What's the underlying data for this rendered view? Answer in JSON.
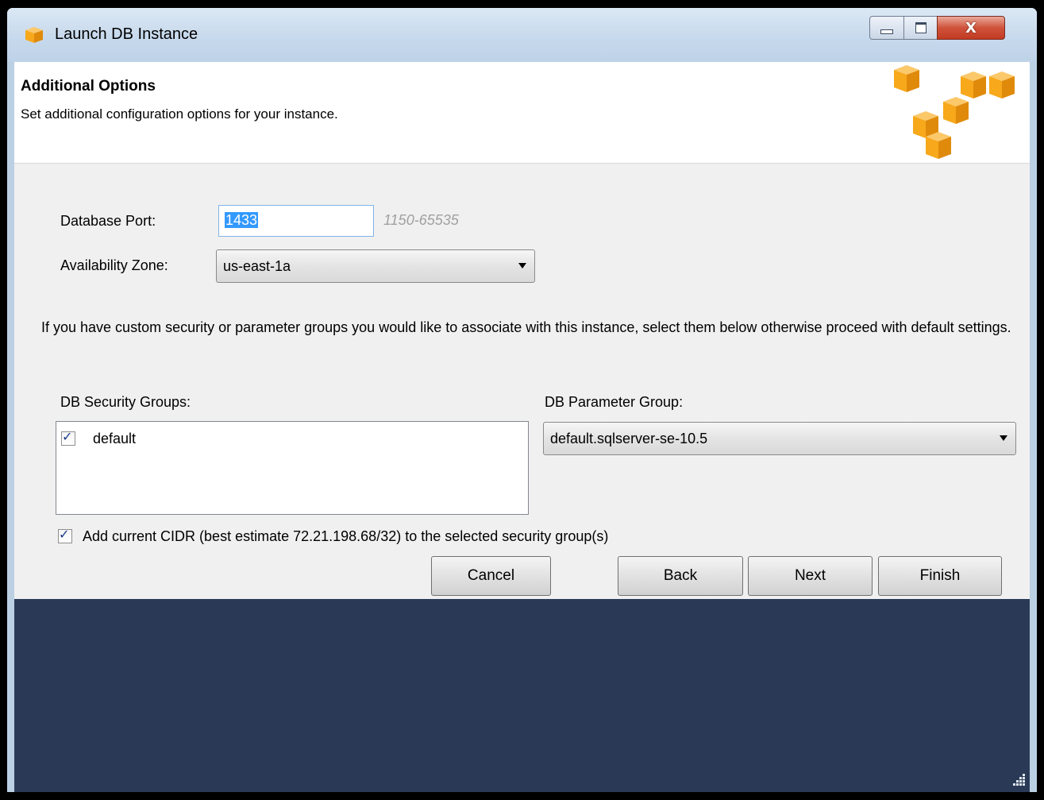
{
  "window": {
    "title": "Launch DB Instance",
    "close_glyph": "X"
  },
  "header": {
    "title": "Additional Options",
    "subtitle": "Set additional configuration options for your instance."
  },
  "form": {
    "port_label": "Database Port:",
    "port_value": "1433",
    "port_hint": "1150-65535",
    "zone_label": "Availability Zone:",
    "zone_value": "us-east-1a"
  },
  "info_text": "If you have custom security or parameter groups you would like to associate with this instance, select them below otherwise proceed with default settings.",
  "security_groups": {
    "label": "DB Security Groups:",
    "items": [
      {
        "label": "default",
        "checked": true
      }
    ]
  },
  "parameter_group": {
    "label": "DB Parameter Group:",
    "value": "default.sqlserver-se-10.5"
  },
  "cidr": {
    "label": "Add current CIDR (best estimate 72.21.198.68/32) to the selected security group(s)",
    "checked": true
  },
  "buttons": {
    "cancel": "Cancel",
    "back": "Back",
    "next": "Next",
    "finish": "Finish"
  },
  "colors": {
    "footer": "#2a3a56",
    "logo_orange": "#f7a81b",
    "selection": "#3399ff"
  },
  "icons": {
    "app": "aws-cubes-icon",
    "minimize": "minimize-icon",
    "maximize": "maximize-icon",
    "close": "close-icon"
  }
}
